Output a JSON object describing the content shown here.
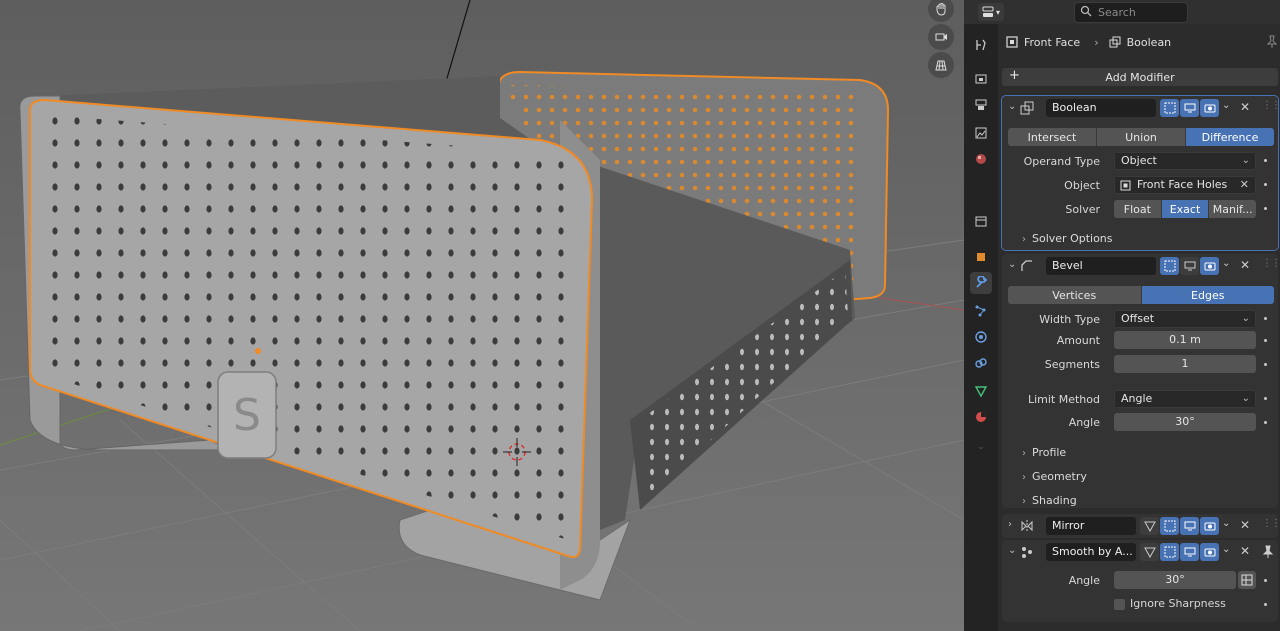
{
  "search": {
    "placeholder": "Search"
  },
  "breadcrumb": {
    "object": "Front Face",
    "modifier": "Boolean"
  },
  "add_modifier": "Add Modifier",
  "boolean": {
    "name": "Boolean",
    "operations": [
      "Intersect",
      "Union",
      "Difference"
    ],
    "active_operation": "Difference",
    "operand_type_label": "Operand Type",
    "operand_type_value": "Object",
    "object_label": "Object",
    "object_value": "Front Face Holes",
    "solver_label": "Solver",
    "solvers": [
      "Float",
      "Exact",
      "Manif..."
    ],
    "active_solver": "Exact",
    "solver_options": "Solver Options"
  },
  "bevel": {
    "name": "Bevel",
    "affect": [
      "Vertices",
      "Edges"
    ],
    "active_affect": "Edges",
    "width_type_label": "Width Type",
    "width_type_value": "Offset",
    "amount_label": "Amount",
    "amount_value": "0.1 m",
    "segments_label": "Segments",
    "segments_value": "1",
    "limit_method_label": "Limit Method",
    "limit_method_value": "Angle",
    "angle_label": "Angle",
    "angle_value": "30°",
    "subpanels": [
      "Profile",
      "Geometry",
      "Shading"
    ]
  },
  "mirror": {
    "name": "Mirror"
  },
  "smooth": {
    "name": "Smooth by A...",
    "angle_label": "Angle",
    "angle_value": "30°",
    "ignore_sharpness": "Ignore Sharpness"
  },
  "viewport": {
    "logo_letter": "S"
  },
  "colors": {
    "accent": "#4772b3",
    "selection": "#f0932b",
    "panel": "#333333",
    "viewport_bg": "#6b6b6b"
  }
}
